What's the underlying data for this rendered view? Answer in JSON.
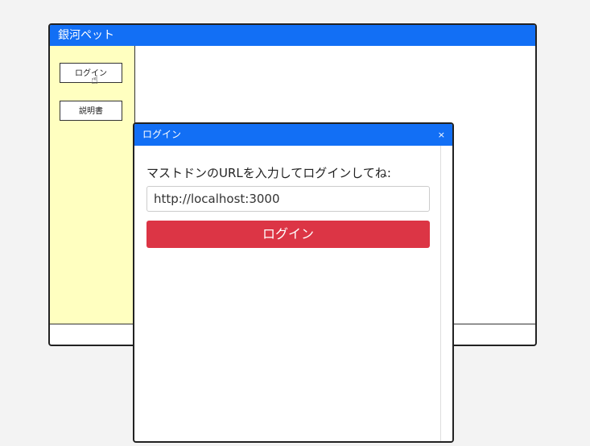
{
  "main_window": {
    "title": "銀河ペット",
    "sidebar": {
      "items": [
        {
          "label": "ログイン"
        },
        {
          "label": "説明書"
        }
      ]
    }
  },
  "dialog": {
    "title": "ログイン",
    "close_label": "×",
    "prompt": "マストドンのURLを入力してログインしてね:",
    "url_value": "http://localhost:3000",
    "login_label": "ログイン"
  },
  "colors": {
    "titlebar": "#126ff5",
    "sidebar_bg": "#ffffc0",
    "login_button": "#dc3545"
  }
}
